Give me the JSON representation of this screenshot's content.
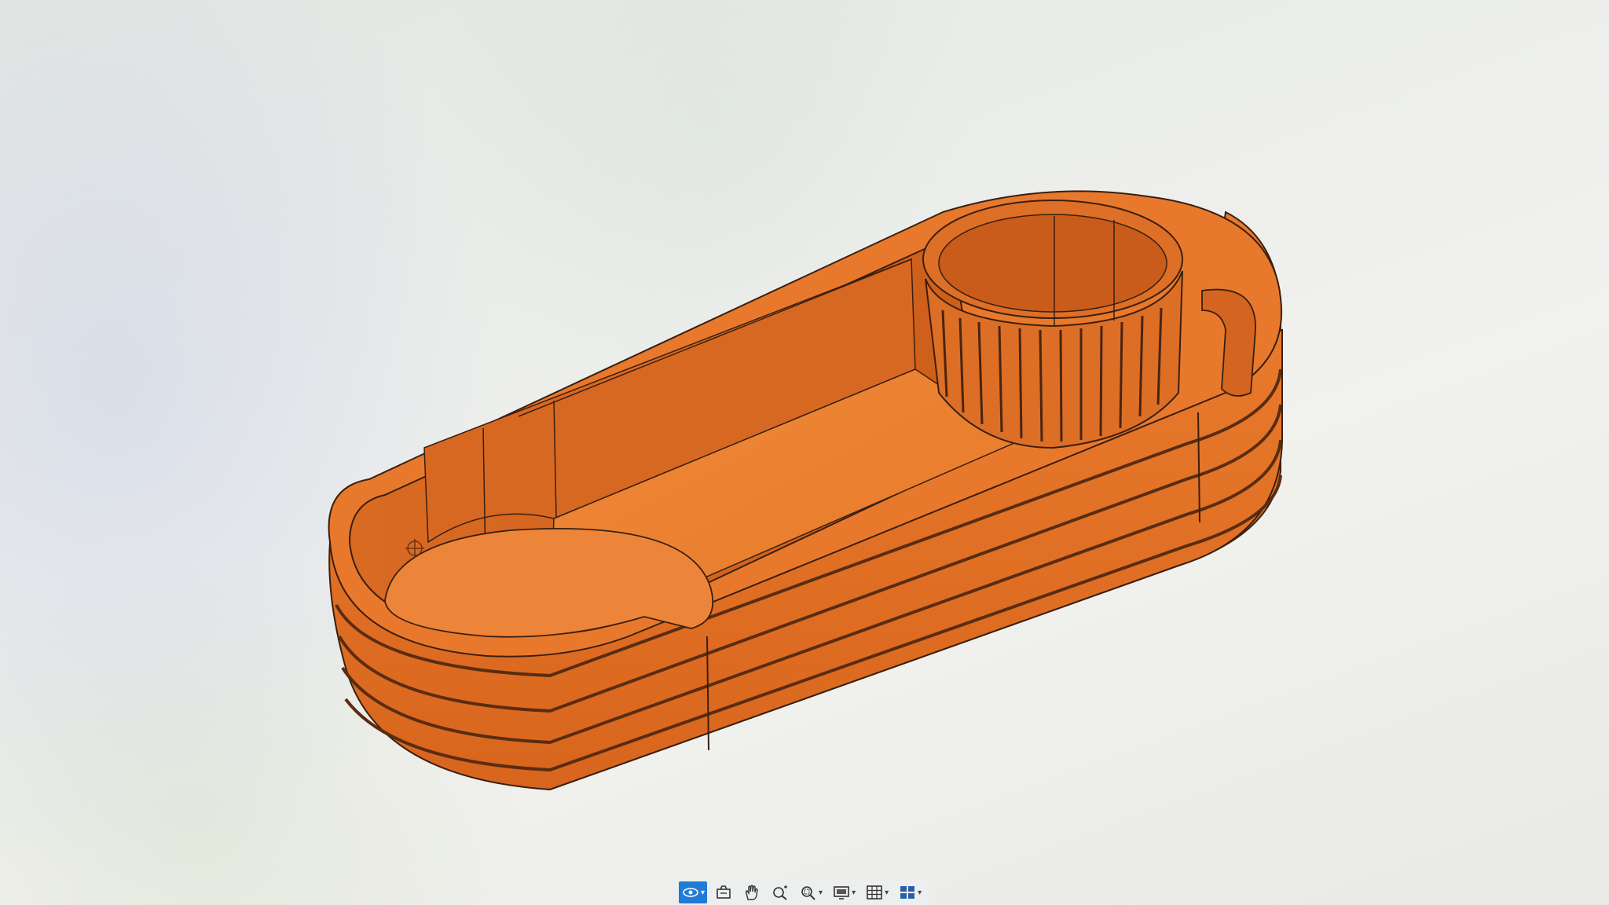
{
  "app": {
    "view": "3d-viewport",
    "background_color": "#eceeea"
  },
  "model": {
    "color": "#e4752a",
    "shade_color": "#b85618",
    "edge_color": "#3a1f10"
  },
  "toolbar": {
    "items": [
      {
        "icon": "orbit-icon",
        "active": true,
        "dropdown": true
      },
      {
        "icon": "look-at-icon",
        "active": false,
        "dropdown": false
      },
      {
        "icon": "pan-hand-icon",
        "active": false,
        "dropdown": false
      },
      {
        "icon": "zoom-icon",
        "active": false,
        "dropdown": false
      },
      {
        "icon": "zoom-window-icon",
        "active": false,
        "dropdown": true
      },
      {
        "icon": "display-settings-icon",
        "active": false,
        "dropdown": true
      },
      {
        "icon": "grid-icon",
        "active": false,
        "dropdown": true
      },
      {
        "icon": "viewports-icon",
        "active": false,
        "dropdown": true
      }
    ],
    "caret": "▾"
  }
}
